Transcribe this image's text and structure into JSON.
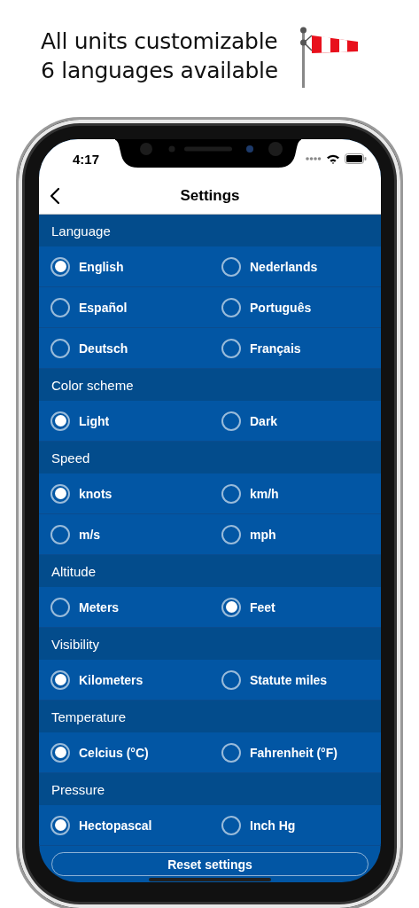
{
  "promo": {
    "lines": [
      "All units customizable",
      "6 languages available"
    ]
  },
  "status_bar": {
    "time": "4:17"
  },
  "nav": {
    "title": "Settings"
  },
  "sections": [
    {
      "title": "Language",
      "options": [
        {
          "label": "English",
          "selected": true
        },
        {
          "label": "Nederlands",
          "selected": false
        },
        {
          "label": "Español",
          "selected": false
        },
        {
          "label": "Português",
          "selected": false
        },
        {
          "label": "Deutsch",
          "selected": false
        },
        {
          "label": "Français",
          "selected": false
        }
      ]
    },
    {
      "title": "Color scheme",
      "options": [
        {
          "label": "Light",
          "selected": true
        },
        {
          "label": "Dark",
          "selected": false
        }
      ]
    },
    {
      "title": "Speed",
      "options": [
        {
          "label": "knots",
          "selected": true
        },
        {
          "label": "km/h",
          "selected": false
        },
        {
          "label": "m/s",
          "selected": false
        },
        {
          "label": "mph",
          "selected": false
        }
      ]
    },
    {
      "title": "Altitude",
      "options": [
        {
          "label": "Meters",
          "selected": false
        },
        {
          "label": "Feet",
          "selected": true
        }
      ]
    },
    {
      "title": "Visibility",
      "options": [
        {
          "label": "Kilometers",
          "selected": true
        },
        {
          "label": "Statute miles",
          "selected": false
        }
      ]
    },
    {
      "title": "Temperature",
      "options": [
        {
          "label": "Celcius (°C)",
          "selected": true
        },
        {
          "label": "Fahrenheit (°F)",
          "selected": false
        }
      ]
    },
    {
      "title": "Pressure",
      "options": [
        {
          "label": "Hectopascal",
          "selected": true
        },
        {
          "label": "Inch Hg",
          "selected": false
        }
      ]
    }
  ],
  "reset_button": {
    "label": "Reset settings"
  }
}
